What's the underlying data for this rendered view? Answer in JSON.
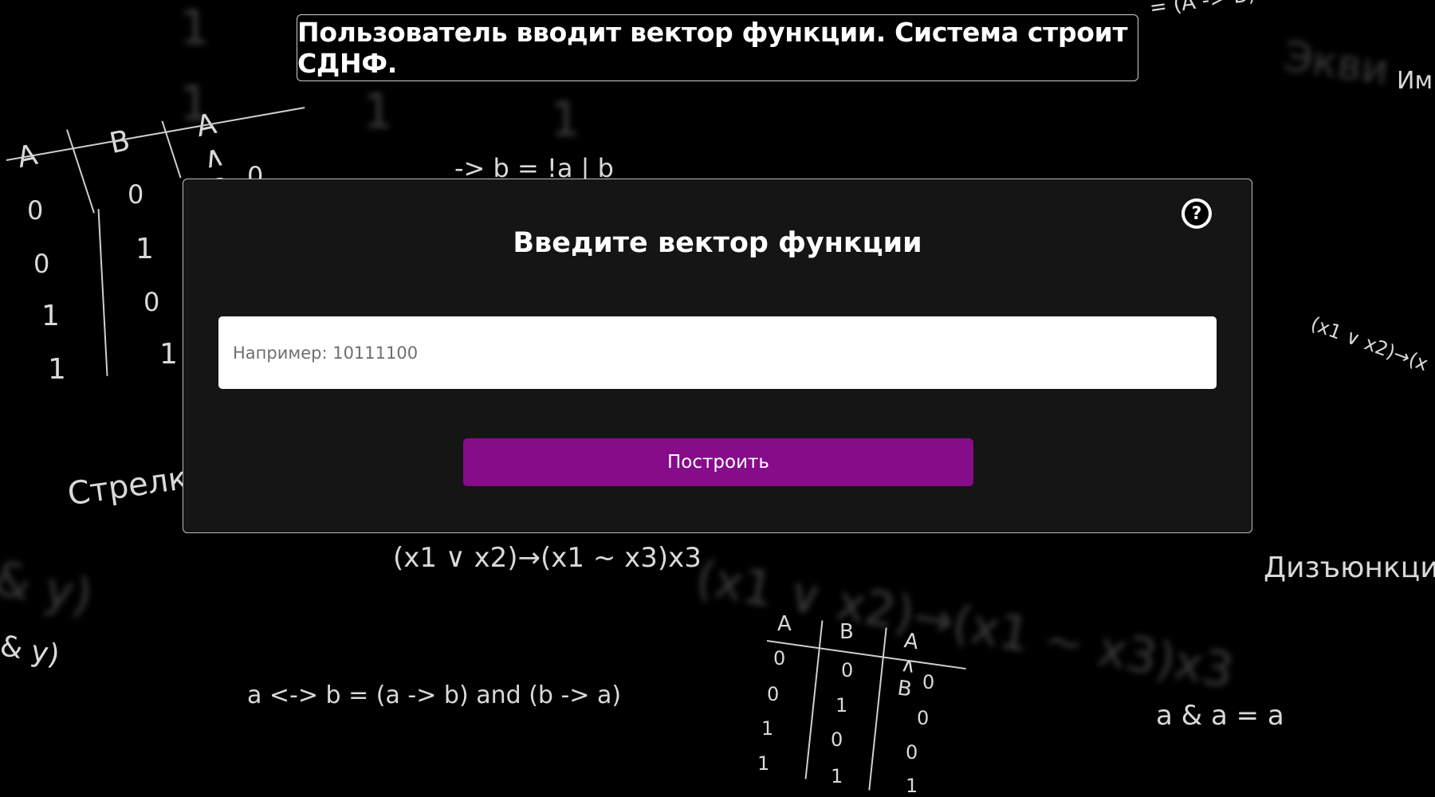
{
  "header": {
    "text": "Пользователь вводит вектор функции. Система строит СДНФ."
  },
  "modal": {
    "title": "Введите вектор функции",
    "help_icon": "question-mark-icon",
    "help_glyph": "?",
    "input": {
      "value": "",
      "placeholder": "Например: 10111100"
    },
    "build_button_label": "Построить"
  },
  "background": {
    "top_right_formula": "= (A -> B) a",
    "top_right_word": "Им",
    "top_right_blur_word": "Экви",
    "mid_formula": "-> b = !a | b",
    "left_word": "Стрелк",
    "right_formula": "(x1 ∨ x2)→(x",
    "center_formula": "(x1 ∨ x2)→(x1 ~ x3)x3",
    "center_formula_blur": "(x1 ∨ x2)→(x1 ~ x3)x3",
    "right_word": "Дизъюнкция",
    "left_bottom_formula": "& y)",
    "left_blur_formula": "& y)",
    "equiv_formula": "a <-> b = (a -> b) and (b -> a)",
    "idempotence_formula": "a & a = a",
    "table1": {
      "headers": [
        "A",
        "B",
        "A ∧ B"
      ],
      "col_a": [
        "0",
        "0",
        "1",
        "1"
      ],
      "col_b": [
        "0",
        "1",
        "0",
        "1"
      ],
      "col_ab_visible": "0"
    },
    "table2": {
      "headers": [
        "A",
        "B",
        "A ∧ B"
      ],
      "col_a": [
        "0",
        "0",
        "1",
        "1"
      ],
      "col_b": [
        "0",
        "1",
        "0",
        "1"
      ],
      "col_ab": [
        "0",
        "0",
        "0",
        "1"
      ]
    },
    "blur_ones": [
      "1",
      "1",
      "1",
      "1"
    ]
  }
}
